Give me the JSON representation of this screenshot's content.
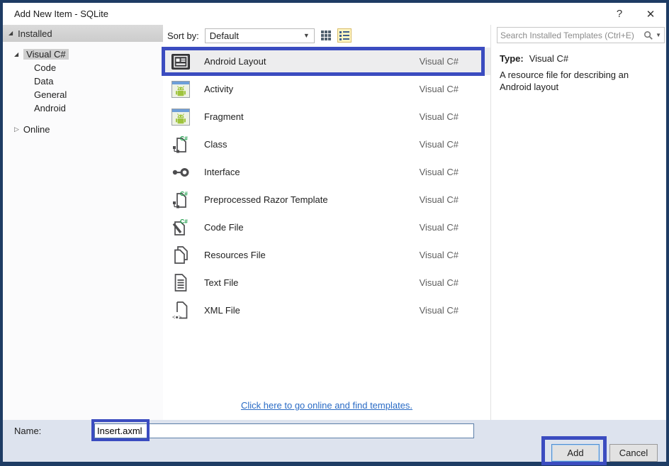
{
  "window": {
    "title": "Add New Item - SQLite",
    "help": "?",
    "close": "✕"
  },
  "sidebar": {
    "installed_label": "Installed",
    "visual_csharp_label": "Visual C#",
    "categories": [
      "Code",
      "Data",
      "General",
      "Android"
    ],
    "online_label": "Online"
  },
  "toolbar": {
    "sort_by_label": "Sort by:",
    "sort_value": "Default"
  },
  "templates": {
    "items": [
      {
        "name": "Android Layout",
        "lang": "Visual C#",
        "icon": "android-layout",
        "selected": true
      },
      {
        "name": "Activity",
        "lang": "Visual C#",
        "icon": "android-activity",
        "selected": false
      },
      {
        "name": "Fragment",
        "lang": "Visual C#",
        "icon": "android-fragment",
        "selected": false
      },
      {
        "name": "Class",
        "lang": "Visual C#",
        "icon": "csharp-class",
        "selected": false
      },
      {
        "name": "Interface",
        "lang": "Visual C#",
        "icon": "interface",
        "selected": false
      },
      {
        "name": "Preprocessed Razor Template",
        "lang": "Visual C#",
        "icon": "csharp-class",
        "selected": false
      },
      {
        "name": "Code File",
        "lang": "Visual C#",
        "icon": "code-file",
        "selected": false
      },
      {
        "name": "Resources File",
        "lang": "Visual C#",
        "icon": "resources-file",
        "selected": false
      },
      {
        "name": "Text File",
        "lang": "Visual C#",
        "icon": "text-file",
        "selected": false
      },
      {
        "name": "XML File",
        "lang": "Visual C#",
        "icon": "xml-file",
        "selected": false
      }
    ],
    "online_link": "Click here to go online and find templates."
  },
  "details": {
    "search_placeholder": "Search Installed Templates (Ctrl+E)",
    "type_label": "Type:",
    "type_value": "Visual C#",
    "description": "A resource file for describing an Android layout"
  },
  "footer": {
    "name_label": "Name:",
    "name_value": "Insert.axml",
    "add_label": "Add",
    "cancel_label": "Cancel"
  },
  "colors": {
    "annotation": "#3b4cc0",
    "window_border": "#1e3c64",
    "link": "#2a6bc5",
    "selection_gray": "#cfcfcf",
    "footer_bg": "#dde3ee",
    "android_green": "#9fc43d"
  }
}
